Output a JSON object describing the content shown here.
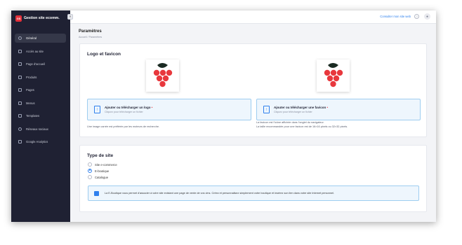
{
  "brand": {
    "logo_text": "GS",
    "title": "Gestion site ecomm."
  },
  "sidebar": {
    "items": [
      {
        "label": "Général",
        "icon": "settings-icon"
      },
      {
        "label": "Accès au site",
        "icon": "lock-icon"
      },
      {
        "label": "Page d'accueil",
        "icon": "home-grid-icon"
      },
      {
        "label": "Produits",
        "icon": "box-icon"
      },
      {
        "label": "Pages",
        "icon": "page-edit-icon"
      },
      {
        "label": "Menus",
        "icon": "menu-icon"
      },
      {
        "label": "Templates",
        "icon": "template-icon"
      },
      {
        "label": "Réseaux sociaux",
        "icon": "share-icon"
      },
      {
        "label": "Google Analytics",
        "icon": "analytics-icon"
      }
    ]
  },
  "topbar": {
    "site_link": "Consulter mon site web",
    "help_glyph": "?",
    "user_glyph": "●"
  },
  "header": {
    "title": "Paramètres",
    "breadcrumb": "Accueil  /  Paramètres"
  },
  "logo_section": {
    "title": "Logo et favicon",
    "logo_upload": {
      "title": "Ajouter ou télécharger un logo",
      "required_mark": "•",
      "subtitle": "Cliquez pour télécharger un fichier"
    },
    "favicon_upload": {
      "title": "Ajouter ou télécharger une favicon",
      "required_mark": "•",
      "subtitle": "Cliquez pour télécharger un fichier"
    },
    "logo_hint": "Une image carrée est préférée par les moteurs de recherche.",
    "favicon_hint_1": "La favicon est l'icône affichée dans l'onglet du navigateur.",
    "favicon_hint_2": "La taille recommandée pour une favicon est de 16×16 pixels ou 32×32 pixels."
  },
  "site_type": {
    "title": "Type de site",
    "options": [
      {
        "label": "Site e-commerce",
        "checked": false
      },
      {
        "label": "E-boutique",
        "checked": true
      },
      {
        "label": "Catalogue",
        "checked": false
      }
    ],
    "info_text": "La E-Boutique vous permet d'associer à votre site existant une page de vente de vos vins. Créez et personnalisez simplement votre boutique et insérez son lien dans votre site Internet personnel."
  },
  "colors": {
    "accent": "#2f80ed",
    "brand_red": "#e5303a",
    "sidebar_bg": "#1f2133",
    "grape_red": "#e8383d",
    "leaf_dark": "#1a2a22"
  }
}
